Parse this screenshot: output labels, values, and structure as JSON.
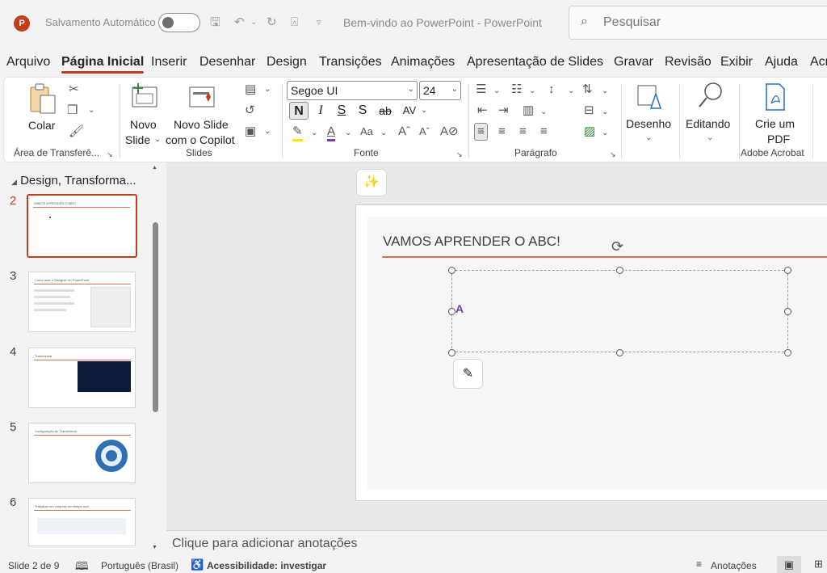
{
  "titlebar": {
    "autosave_label": "Salvamento Automático",
    "doc_title": "Bem-vindo ao PowerPoint  -  PowerPoint",
    "search_placeholder": "Pesquisar"
  },
  "menu": {
    "tabs": [
      "Arquivo",
      "Página Inicial",
      "Inserir",
      "Desenhar",
      "Design",
      "Transições",
      "Animações",
      "Apresentação de Slides",
      "Gravar",
      "Revisão",
      "Exibir",
      "Ajuda",
      "Acr"
    ],
    "active": "Página Inicial"
  },
  "ribbon": {
    "clipboard": {
      "paste_label": "Colar",
      "group_label": "Área de Transferê..."
    },
    "slides": {
      "new_slide_line1": "Novo",
      "new_slide_line2": "Slide",
      "copilot_line1": "Novo Slide",
      "copilot_line2": "com o Copilot",
      "group_label": "Slides"
    },
    "font": {
      "family": "Segoe UI",
      "size": "24",
      "group_label": "Fonte"
    },
    "paragraph": {
      "group_label": "Parágrafo"
    },
    "drawing": {
      "label": "Desenho"
    },
    "editing": {
      "label": "Editando"
    },
    "acrobat": {
      "line1": "Crie um",
      "line2": "PDF",
      "group_label": "Adobe Acrobat"
    },
    "format_buttons": [
      "N",
      "I",
      "S",
      "S",
      "ab",
      "AV"
    ]
  },
  "leftpane": {
    "section_title": "Design, Transforma...",
    "slides": [
      {
        "num": "2",
        "title": "VAMOS APRENDER O ABC!",
        "active": true
      },
      {
        "num": "3",
        "title": "Como usar o Designer do PowerPoint",
        "active": false
      },
      {
        "num": "4",
        "title": "Transformar",
        "active": false
      },
      {
        "num": "5",
        "title": "Configuração do Transformar",
        "active": false
      },
      {
        "num": "6",
        "title": "Trabalhar em conjunto em tempo real",
        "active": false
      }
    ]
  },
  "slide": {
    "title": "VAMOS APRENDER O ABC!",
    "textbox_content": "A"
  },
  "notes_placeholder": "Clique para adicionar anotações",
  "statusbar": {
    "slide_count": "Slide 2 de 9",
    "language": "Português (Brasil)",
    "accessibility": "Acessibilidade: investigar",
    "notes": "Anotações"
  },
  "colors": {
    "accent": "#c43e1c",
    "rule": "#d9734f",
    "text_purple": "#7b3ab5"
  }
}
